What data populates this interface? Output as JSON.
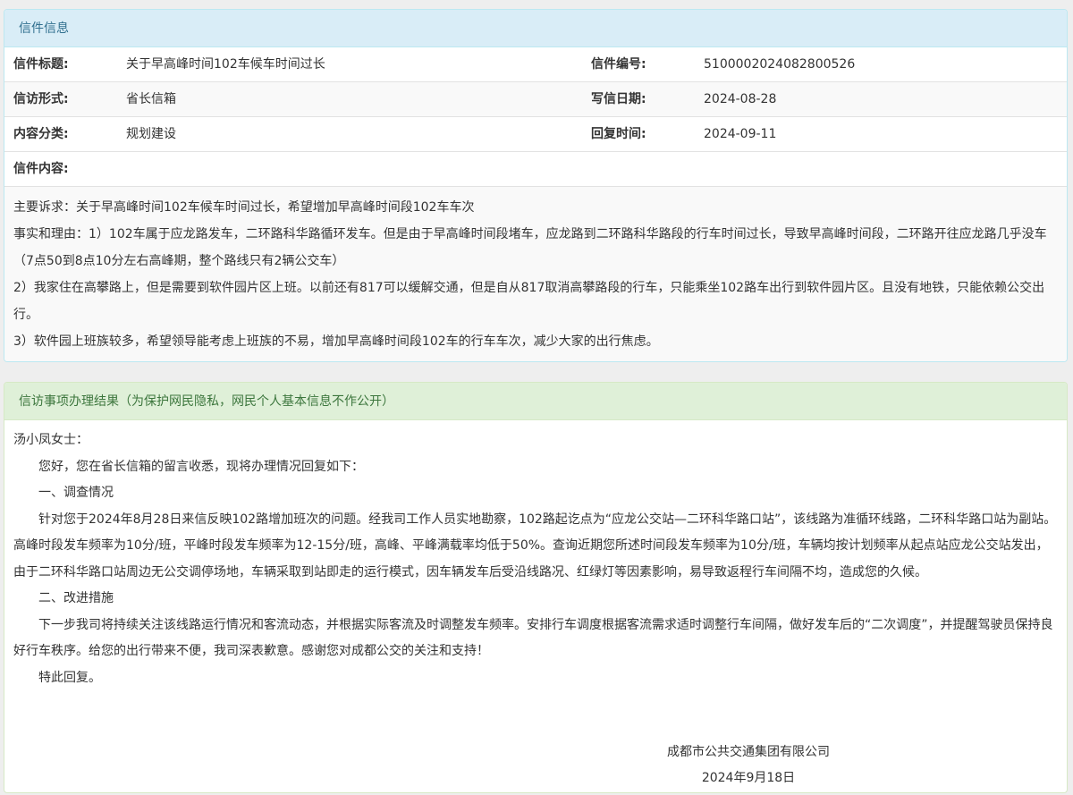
{
  "letter_panel": {
    "heading": "信件信息",
    "rows": [
      {
        "label1": "信件标题:",
        "value1": "关于早高峰时间102车候车时间过长",
        "label2": "信件编号:",
        "value2": "5100002024082800526"
      },
      {
        "label1": "信访形式:",
        "value1": "省长信箱",
        "label2": "写信日期:",
        "value2": "2024-08-28"
      },
      {
        "label1": "内容分类:",
        "value1": "规划建设",
        "label2": "回复时间:",
        "value2": "2024-09-11"
      }
    ],
    "content_label": "信件内容:",
    "content_lines": [
      "主要诉求：关于早高峰时间102车候车时间过长，希望增加早高峰时间段102车车次",
      "事实和理由：1）102车属于应龙路发车，二环路科华路循环发车。但是由于早高峰时间段堵车，应龙路到二环路科华路段的行车时间过长，导致早高峰时间段，二环路开往应龙路几乎没车（7点50到8点10分左右高峰期，整个路线只有2辆公交车）",
      "2）我家住在高攀路上，但是需要到软件园片区上班。以前还有817可以缓解交通，但是自从817取消高攀路段的行车，只能乘坐102路车出行到软件园片区。且没有地铁，只能依赖公交出行。",
      "3）软件园上班族较多，希望领导能考虑上班族的不易，增加早高峰时间段102车的行车车次，减少大家的出行焦虑。"
    ]
  },
  "result_panel": {
    "heading": "信访事项办理结果（为保护网民隐私，网民个人基本信息不作公开）",
    "greeting": "汤小凤女士：",
    "paragraphs": [
      "您好，您在省长信箱的留言收悉，现将办理情况回复如下：",
      "一、调查情况",
      "针对您于2024年8月28日来信反映102路增加班次的问题。经我司工作人员实地勘察，102路起讫点为“应龙公交站—二环科华路口站”，该线路为准循环线路，二环科华路口站为副站。高峰时段发车频率为10分/班，平峰时段发车频率为12-15分/班，高峰、平峰满载率均低于50%。查询近期您所述时间段发车频率为10分/班，车辆均按计划频率从起点站应龙公交站发出，由于二环科华路口站周边无公交调停场地，车辆采取到站即走的运行模式，因车辆发车后受沿线路况、红绿灯等因素影响，易导致返程行车间隔不均，造成您的久候。",
      "二、改进措施",
      "下一步我司将持续关注该线路运行情况和客流动态，并根据实际客流及时调整发车频率。安排行车调度根据客流需求适时调整行车间隔，做好发车后的“二次调度”，并提醒驾驶员保持良好行车秩序。给您的出行带来不便，我司深表歉意。感谢您对成都公交的关注和支持！",
      "特此回复。"
    ],
    "signature_org": "成都市公共交通集团有限公司",
    "signature_date": "2024年9月18日"
  }
}
